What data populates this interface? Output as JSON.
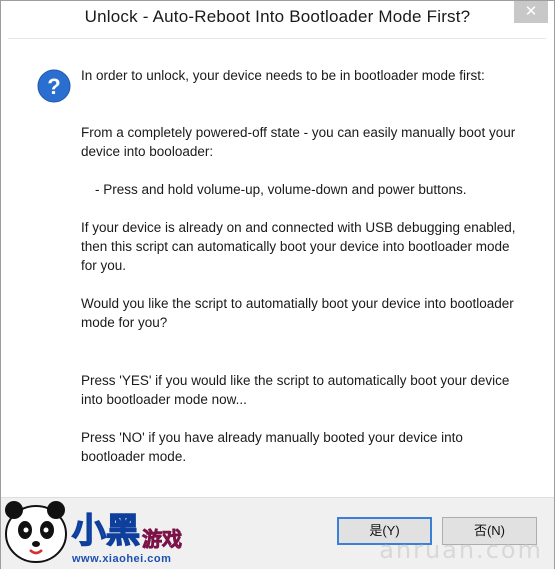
{
  "dialog": {
    "title": "Unlock - Auto-Reboot Into Bootloader Mode First?",
    "close_label": "✕"
  },
  "icon": "question-icon",
  "message": {
    "p1": "In order to unlock, your device needs to be in bootloader mode first:",
    "p2": "From a completely powered-off state - you can easily manually boot your device into booloader:",
    "p3": "- Press and hold volume-up, volume-down and power buttons.",
    "p4": "If your device is already on and connected with USB debugging enabled, then this script can automatically boot your device into bootloader mode for you.",
    "p5": "Would you like the script to automatially boot your device into bootloader mode for you?",
    "p6": "Press 'YES' if you would like the script to automatically boot your device into bootloader mode now...",
    "p7": "Press 'NO' if you have already manually booted your device into bootloader mode."
  },
  "buttons": {
    "yes_label": "是(Y)",
    "no_label": "否(N)"
  },
  "watermark": {
    "site_url": "www.xiaohei.com",
    "logo_text": "小黑游戏",
    "brand": "anruan.com"
  },
  "colors": {
    "accent": "#3c7fd6",
    "icon_blue": "#2a6fd0",
    "footer_bg": "#f0f0f0"
  }
}
